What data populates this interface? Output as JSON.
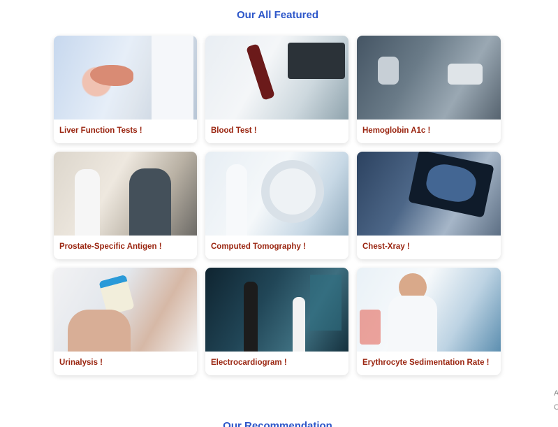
{
  "section": {
    "title": "Our All Featured"
  },
  "cards": [
    {
      "label": "Liver Function Tests !"
    },
    {
      "label": "Blood Test !"
    },
    {
      "label": "Hemoglobin A1c !"
    },
    {
      "label": "Prostate-Specific Antigen !"
    },
    {
      "label": "Computed Tomography !"
    },
    {
      "label": "Chest-Xray !"
    },
    {
      "label": "Urinalysis !"
    },
    {
      "label": "Electrocardiogram !"
    },
    {
      "label": "Erythrocyte Sedimentation Rate !"
    }
  ],
  "next_section": {
    "title": "Our Recommendation"
  },
  "edge": {
    "line1": "A",
    "line2": "C"
  }
}
